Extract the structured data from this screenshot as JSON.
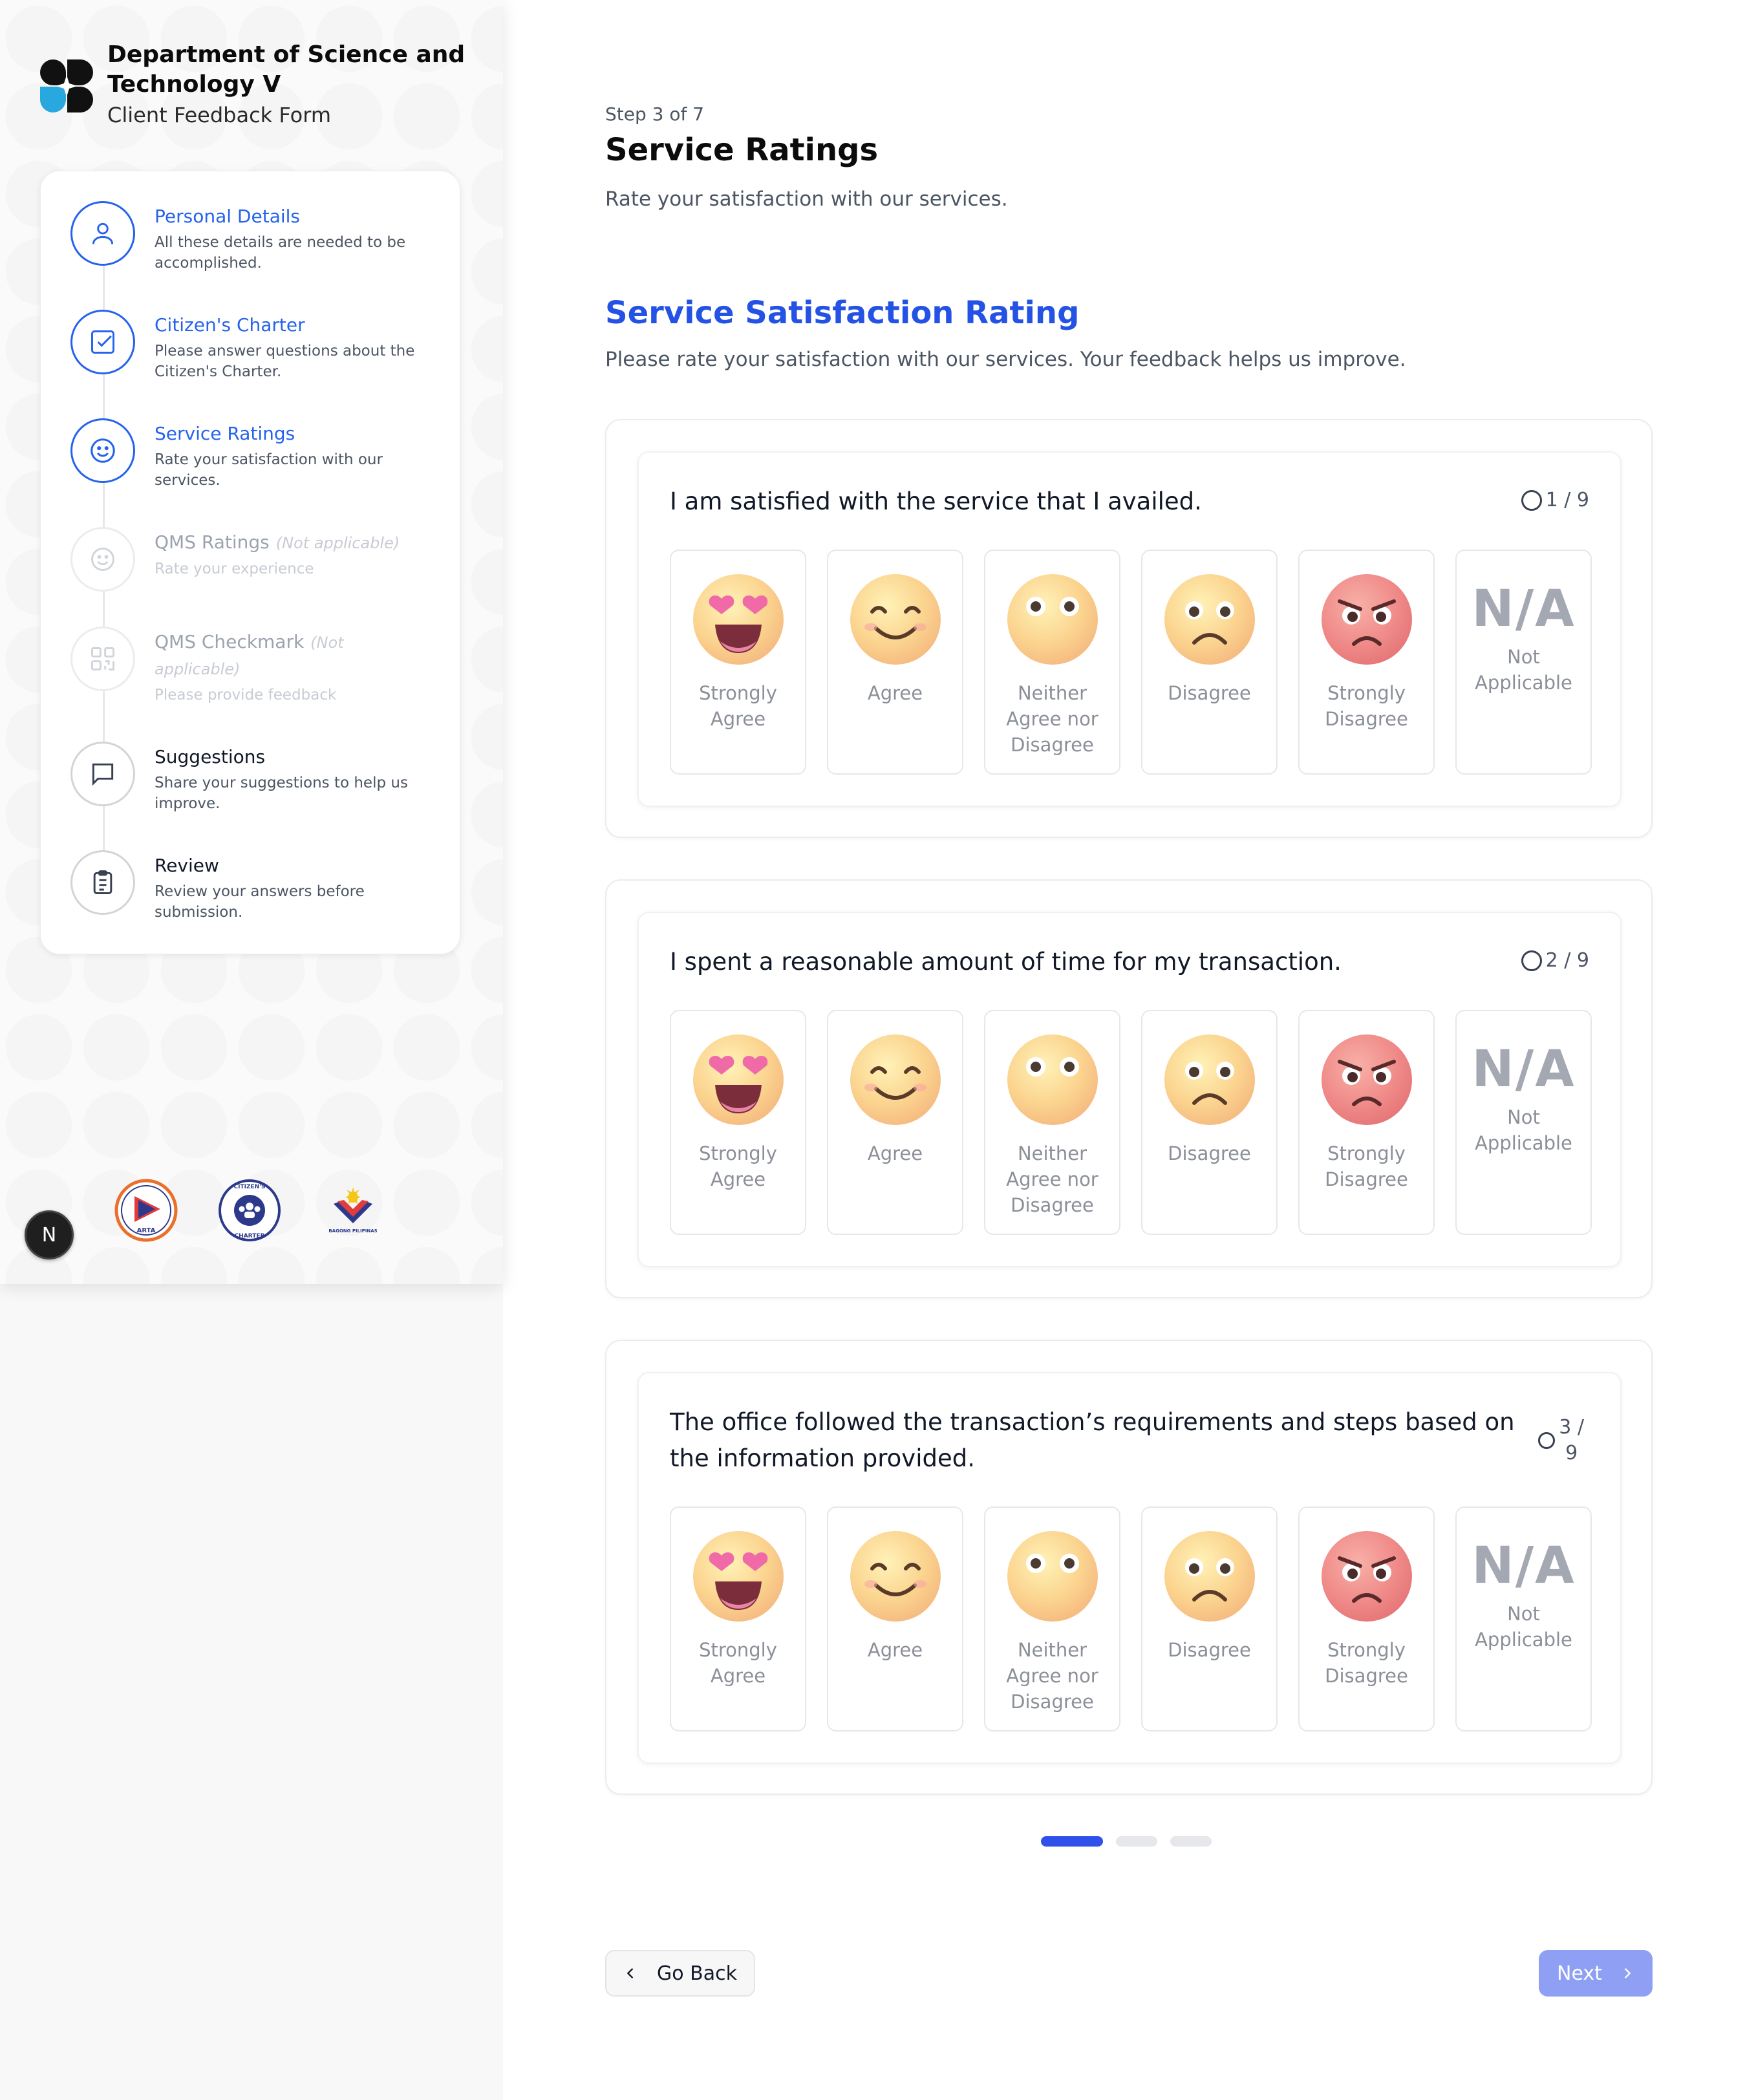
{
  "brand": {
    "title": "Department of Science and Technology V",
    "subtitle": "Client Feedback Form"
  },
  "steps": [
    {
      "title": "Personal Details",
      "desc": "All these details are needed to be accomplished.",
      "state": "active",
      "icon": "user-icon"
    },
    {
      "title": "Citizen's Charter",
      "desc": "Please answer questions about the Citizen's Charter.",
      "state": "active",
      "icon": "checkbox-icon"
    },
    {
      "title": "Service Ratings",
      "desc": "Rate your satisfaction with our services.",
      "state": "active",
      "icon": "smile-icon"
    },
    {
      "title": "QMS Ratings",
      "na": "(Not applicable)",
      "desc": "Rate your experience",
      "state": "disabled",
      "icon": "smile-icon"
    },
    {
      "title": "QMS Checkmark",
      "na": "(Not applicable)",
      "desc": "Please provide feedback",
      "state": "disabled",
      "icon": "qr-code-icon"
    },
    {
      "title": "Suggestions",
      "desc": "Share your suggestions to help us improve.",
      "state": "pending",
      "icon": "chat-bubble-icon"
    },
    {
      "title": "Review",
      "desc": "Review your answers before submission.",
      "state": "pending",
      "icon": "clipboard-icon"
    }
  ],
  "agency_logos": [
    {
      "name": "arta-logo",
      "text": "ARTA"
    },
    {
      "name": "citizens-charter-logo",
      "text": "CITIZEN'S CHARTER"
    },
    {
      "name": "bagong-pilipinas-logo",
      "text": "BAGONG PILIPINAS"
    }
  ],
  "dev_badge": "N",
  "main": {
    "step_count": "Step 3 of 7",
    "title": "Service Ratings",
    "subtitle": "Rate your satisfaction with our services.",
    "section_title": "Service Satisfaction Rating",
    "section_subtitle": "Please rate your satisfaction with our services. Your feedback helps us improve."
  },
  "questions": [
    {
      "text": "I am satisfied with the service that I availed.",
      "count": "1 / 9"
    },
    {
      "text": "I spent a reasonable amount of time for my transaction.",
      "count": "2 / 9"
    },
    {
      "text": "The office followed the transaction’s requirements and steps based on the information provided.",
      "count_top": "3 /",
      "count_bottom": "9"
    }
  ],
  "options": [
    "Strongly Agree",
    "Agree",
    "Neither Agree nor Disagree",
    "Disagree",
    "Strongly Disagree"
  ],
  "na_option": {
    "big": "N/A",
    "label": "Not Applicable"
  },
  "pagination": {
    "total": 3,
    "current": 1
  },
  "buttons": {
    "back": "Go Back",
    "next": "Next"
  },
  "colors": {
    "accent": "#2563eb",
    "next_button": "#8fa0f4",
    "active_dot": "#2f50ea"
  }
}
